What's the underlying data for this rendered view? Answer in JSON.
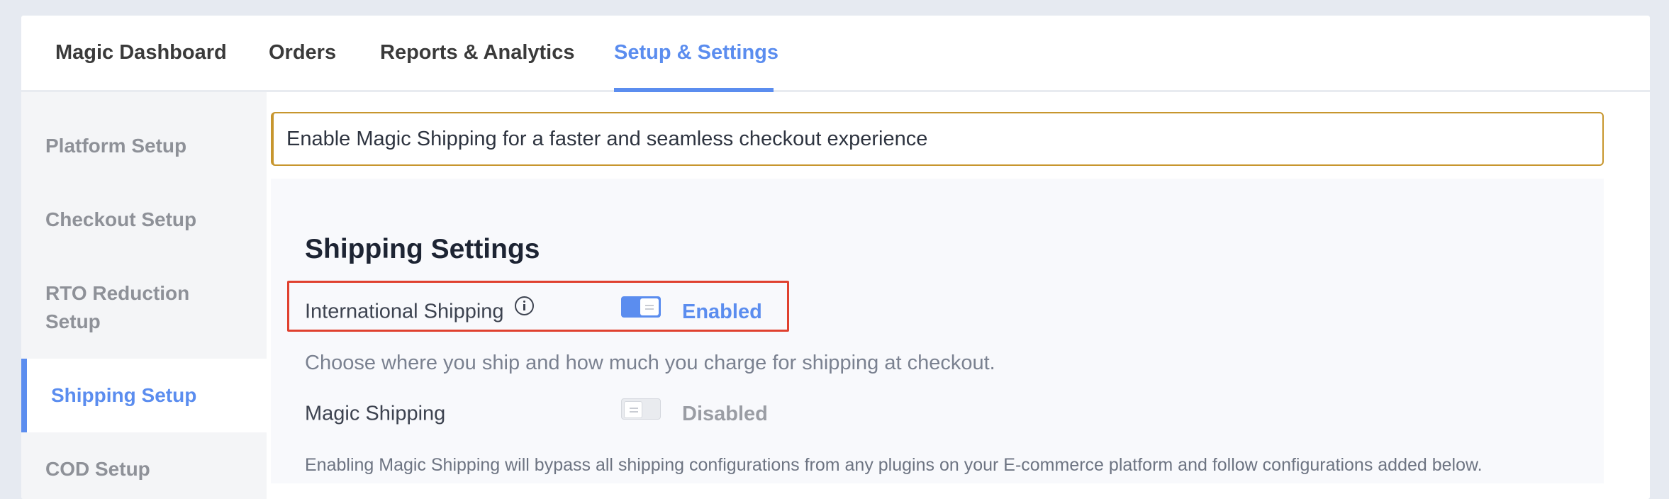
{
  "topnav": {
    "tabs": [
      {
        "label": "Magic Dashboard"
      },
      {
        "label": "Orders"
      },
      {
        "label": "Reports & Analytics"
      },
      {
        "label": "Setup & Settings",
        "active": true
      }
    ]
  },
  "sidebar": {
    "items": [
      {
        "label": "Platform Setup"
      },
      {
        "label": "Checkout Setup"
      },
      {
        "label": "RTO Reduction Setup"
      },
      {
        "label": "Shipping Setup",
        "active": true
      },
      {
        "label": "COD Setup"
      }
    ]
  },
  "banner": {
    "text": "Enable Magic Shipping for a faster and seamless checkout experience"
  },
  "shipping": {
    "title": "Shipping Settings",
    "international": {
      "label": "International Shipping",
      "icon": "info-icon",
      "status": "Enabled"
    },
    "international_desc": "Choose where you ship and how much you charge for shipping at checkout.",
    "magic": {
      "label": "Magic Shipping",
      "status": "Disabled"
    },
    "magic_desc": "Enabling Magic Shipping will bypass all shipping configurations from any plugins on your E-commerce platform and follow configurations added below."
  },
  "colors": {
    "accent": "#5b8def",
    "banner_border": "#c7962e",
    "highlight": "#e0412f"
  }
}
